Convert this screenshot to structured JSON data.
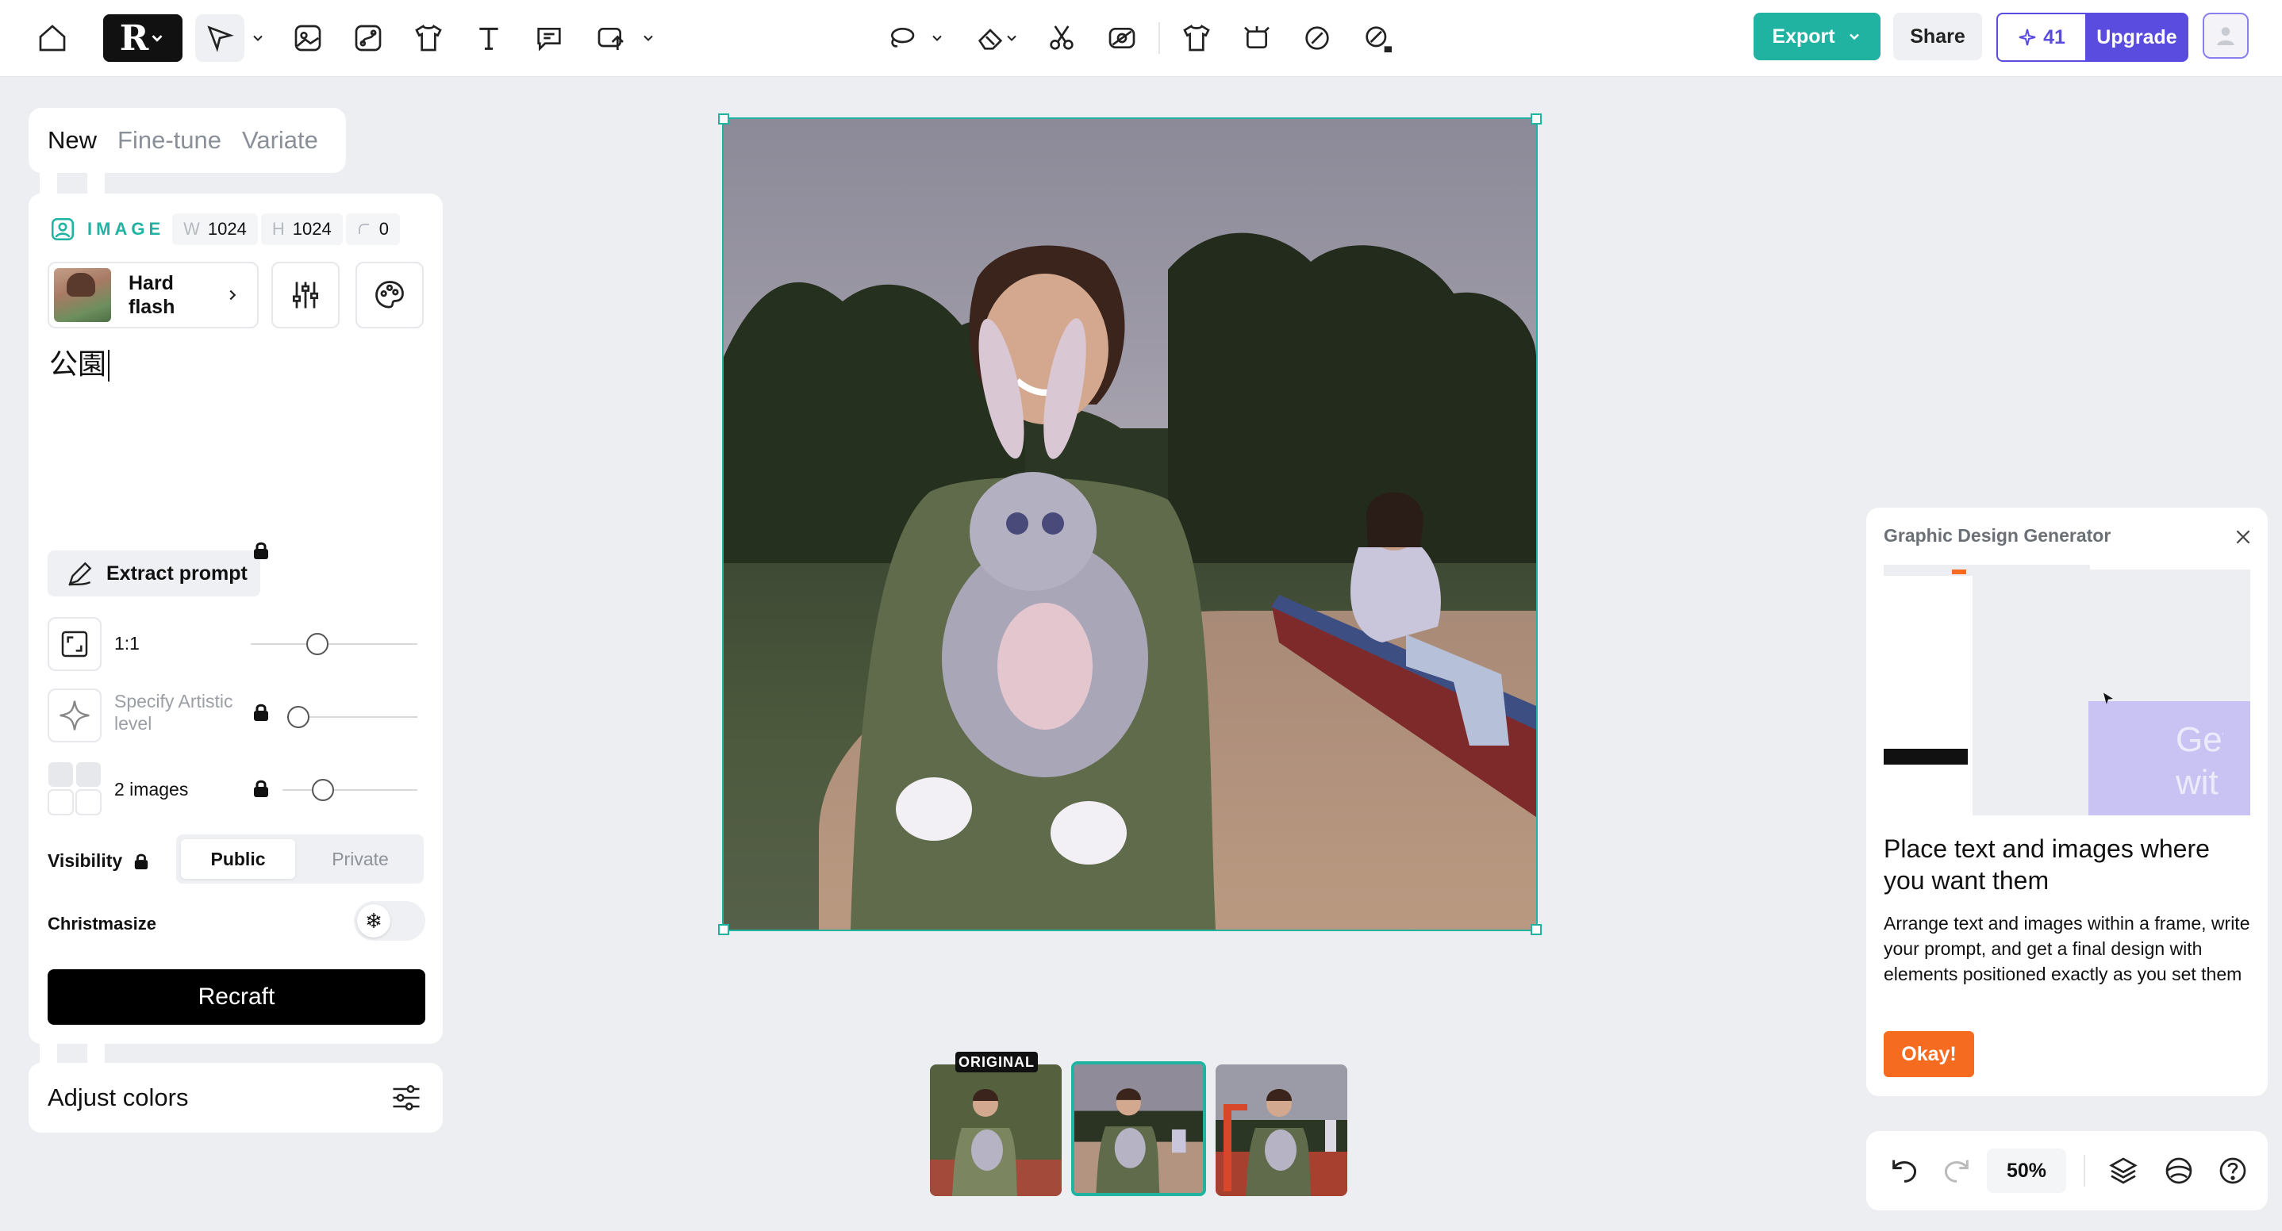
{
  "toolbar": {
    "export_label": "Export",
    "share_label": "Share",
    "credits": "41",
    "upgrade_label": "Upgrade"
  },
  "mode_tabs": [
    {
      "label": "New",
      "active": true
    },
    {
      "label": "Fine-tune",
      "active": false
    },
    {
      "label": "Variate",
      "active": false
    }
  ],
  "image_settings": {
    "type_label": "IMAGE",
    "width_key": "W",
    "width": "1024",
    "height_key": "H",
    "height": "1024",
    "corner": "0"
  },
  "style": {
    "name": "Hard flash"
  },
  "prompt": {
    "text": "公園"
  },
  "extract_prompt_label": "Extract prompt",
  "options": {
    "ratio": {
      "label": "1:1",
      "level": 0.4
    },
    "artistic": {
      "label": "Specify Artistic level",
      "level": 0.05
    },
    "count": {
      "label": "2 images",
      "level": 0.3
    }
  },
  "visibility": {
    "label": "Visibility",
    "options": [
      "Public",
      "Private"
    ],
    "selected": "Public"
  },
  "christmasize": {
    "label": "Christmasize",
    "enabled": false
  },
  "recraft_label": "Recraft",
  "adjust_colors_label": "Adjust colors",
  "thumbnails": {
    "original_badge": "ORIGINAL",
    "count": 3,
    "selected_index": 1
  },
  "tooltip": {
    "title": "Graphic Design Generator",
    "heading": "Place text and images where you want them",
    "body": "Arrange text and images within a frame, write your prompt, and get a final design with elements positioned exactly as you set them",
    "ok_label": "Okay!",
    "preview_text": "Get wit"
  },
  "bottom": {
    "zoom": "50%"
  },
  "colors": {
    "accent": "#21b3a2",
    "upgrade": "#5b4ce0",
    "ok": "#f56b1f"
  }
}
